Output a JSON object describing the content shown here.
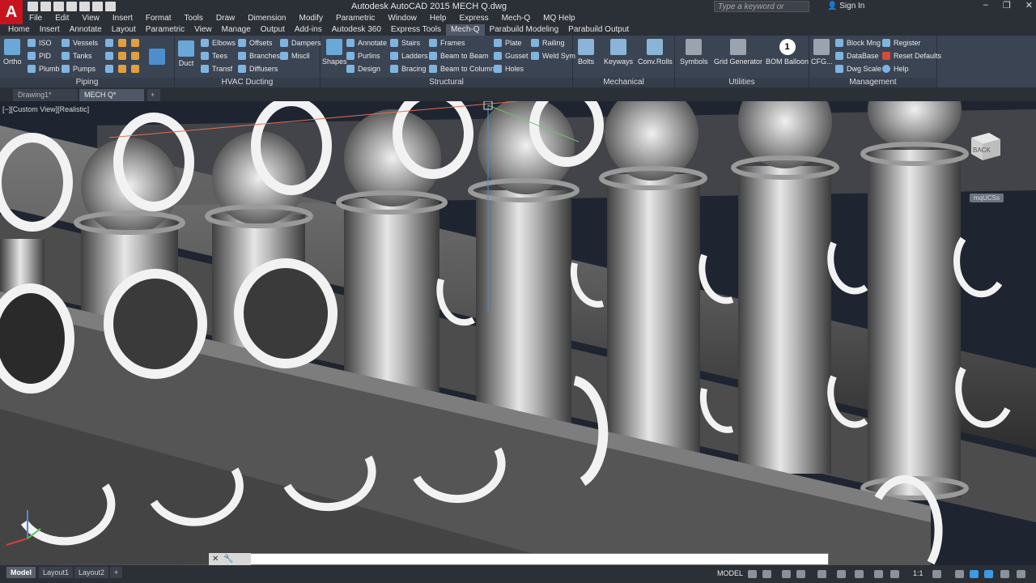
{
  "titlebar": {
    "app_logo": "A",
    "window_title": "Autodesk AutoCAD 2015    MECH Q.dwg",
    "search_placeholder": "Type a keyword or phrase",
    "signin_label": "Sign In",
    "minimize": "–",
    "restore": "❐",
    "close": "✕"
  },
  "menu": [
    "File",
    "Edit",
    "View",
    "Insert",
    "Format",
    "Tools",
    "Draw",
    "Dimension",
    "Modify",
    "Parametric",
    "Window",
    "Help",
    "Express",
    "Mech-Q",
    "MQ Help"
  ],
  "ribbon_tabs": [
    "Home",
    "Insert",
    "Annotate",
    "Layout",
    "Parametric",
    "View",
    "Manage",
    "Output",
    "Add-ins",
    "Autodesk 360",
    "Express Tools",
    "Mech-Q",
    "Parabuild Modeling",
    "Parabuild Output"
  ],
  "ribbon_active_tab": "Mech-Q",
  "ribbon": {
    "piping": {
      "title": "Piping",
      "ortho": "Ortho",
      "iso": "ISO",
      "pid": "PID",
      "plumb": "Plumb",
      "vessels": "Vessels",
      "tanks": "Tanks",
      "pumps": "Pumps"
    },
    "hvac": {
      "title": "HVAC Ducting",
      "duct": "Duct",
      "elbows": "Elbows",
      "tees": "Tees",
      "transf": "Transf",
      "offsets": "Offsets",
      "branches": "Branches",
      "diffusers": "Diffusers",
      "dampers": "Dampers",
      "miscll": "Miscll"
    },
    "structural": {
      "title": "Structural",
      "shapes": "Shapes",
      "annotate": "Annotate",
      "purlins": "Purlins",
      "design": "Design",
      "stairs": "Stairs",
      "ladders": "Ladders",
      "bracing": "Bracing",
      "frames": "Frames",
      "beam_to_beam": "Beam to Beam",
      "beam_to_column": "Beam to Column",
      "plate": "Plate",
      "gusset": "Gusset",
      "holes": "Holes",
      "railing": "Railing",
      "weld_sym": "Weld Sym"
    },
    "mechanical": {
      "title": "Mechanical",
      "bolts": "Bolts",
      "keyways": "Keyways",
      "conv_rolls": "Conv.Rolls"
    },
    "utilities": {
      "title": "Utilities",
      "symbols": "Symbols",
      "grid_generator": "Grid Generator",
      "bom_balloon": "BOM Balloon",
      "balloon_number": "1"
    },
    "management": {
      "title": "Management",
      "cfg": "CFG...",
      "block_mng": "Block Mng",
      "database": "DataBase",
      "dwg_scale": "Dwg Scale",
      "register": "Register",
      "reset_defaults": "Reset Defaults",
      "help": "Help"
    }
  },
  "doc_tabs": [
    "Drawing1*",
    "MECH Q*"
  ],
  "doc_tab_add": "+",
  "viewport": {
    "view_label": "[−][Custom View][Realistic]",
    "viewcube_face": "BACK",
    "wcs_label": "mqUCSs"
  },
  "cmdline": {
    "value": "",
    "close": "✕",
    "settings": "🔧"
  },
  "status": {
    "layout_tabs": [
      "Model",
      "Layout1",
      "Layout2"
    ],
    "add_tab": "+",
    "model_indicator": "MODEL",
    "scale": "1:1"
  },
  "colors": {
    "ribbon_bg": "#3b4453",
    "accent_red": "#c8141e",
    "viewport_bg": "#1e2530",
    "pipe_mid": "#6e6e6e"
  }
}
